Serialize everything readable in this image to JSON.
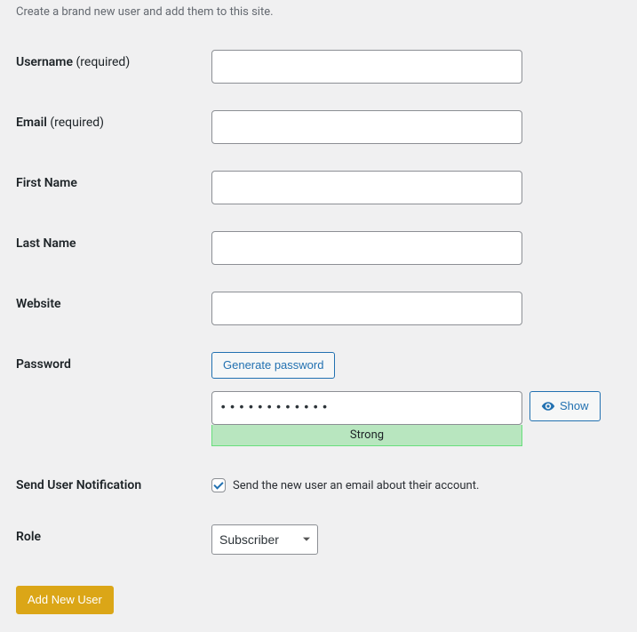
{
  "intro": "Create a brand new user and add them to this site.",
  "labels": {
    "username": "Username",
    "username_req": "(required)",
    "email": "Email",
    "email_req": "(required)",
    "first_name": "First Name",
    "last_name": "Last Name",
    "website": "Website",
    "password": "Password",
    "notification": "Send User Notification",
    "role": "Role"
  },
  "values": {
    "username": "",
    "email": "",
    "first_name": "",
    "last_name": "",
    "website": "",
    "password_masked": "••••••••••••",
    "role_selected": "Subscriber"
  },
  "buttons": {
    "generate_password": "Generate password",
    "show": "Show",
    "submit": "Add New User"
  },
  "strength": "Strong",
  "notification_text": "Send the new user an email about their account."
}
